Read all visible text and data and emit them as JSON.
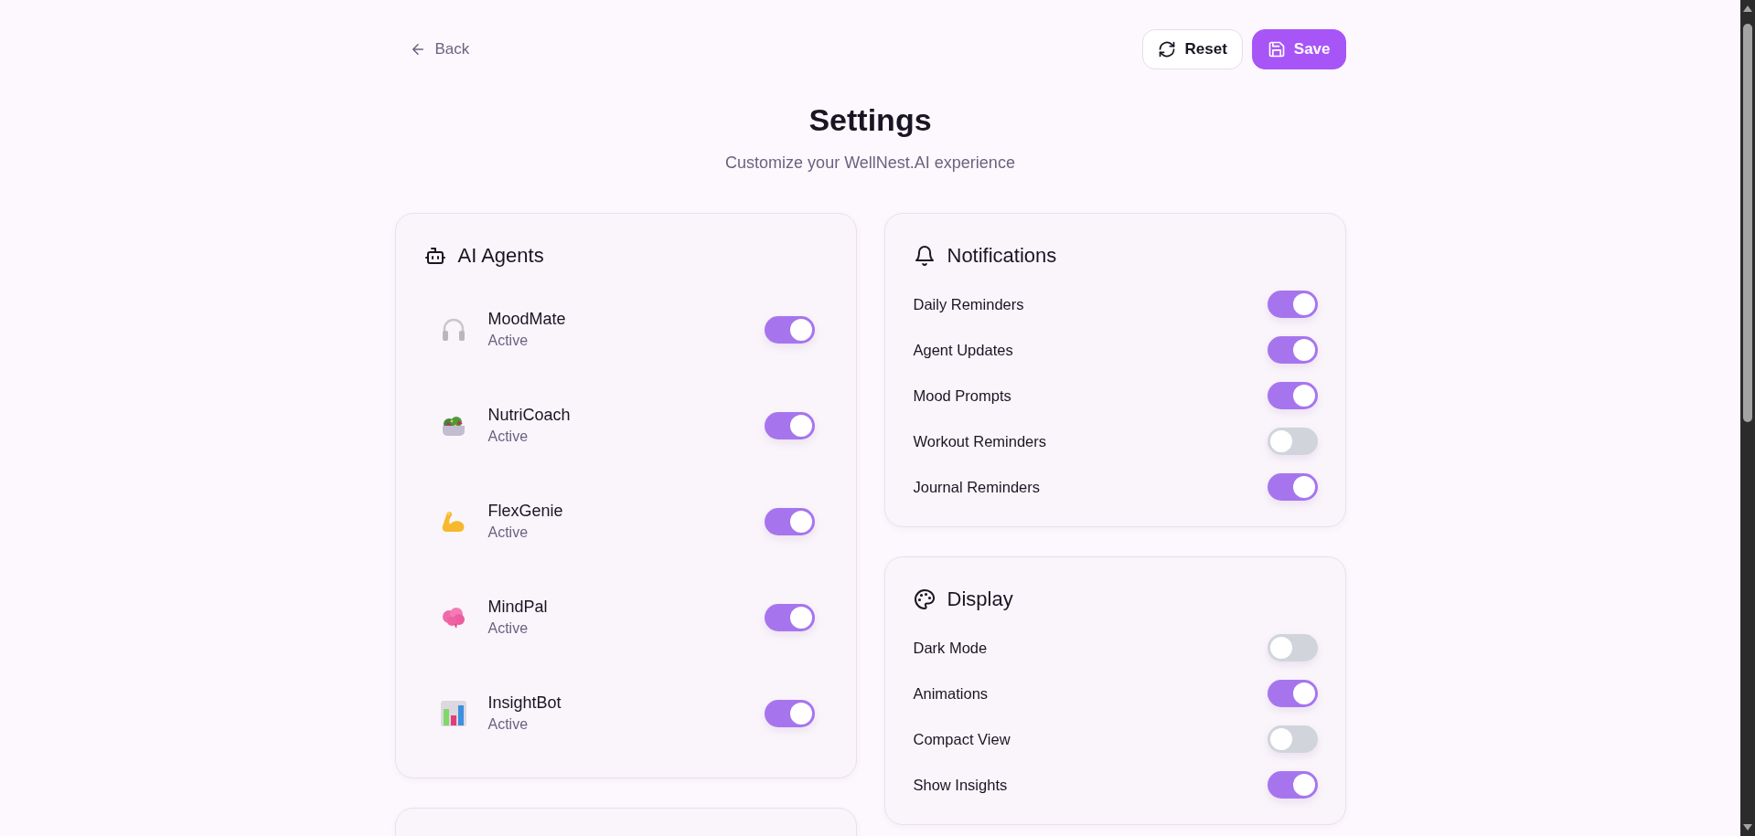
{
  "back_link": "Back",
  "buttons": [
    {
      "label": "Reset",
      "kind": "outline"
    },
    {
      "label": "Save",
      "kind": "primary"
    }
  ],
  "title": "Settings",
  "subtitle": "Customize your WellNest.AI experience",
  "columns": [
    [
      {
        "kind": "agents",
        "title": "AI Agents",
        "agents": [
          {
            "name": "MoodMate",
            "status": "Active",
            "on": true
          },
          {
            "name": "NutriCoach",
            "status": "Active",
            "on": true
          },
          {
            "name": "FlexGenie",
            "status": "Active",
            "on": true
          },
          {
            "name": "MindPal",
            "status": "Active",
            "on": true
          },
          {
            "name": "InsightBot",
            "status": "Active",
            "on": true
          }
        ]
      },
      {
        "kind": "blank"
      }
    ],
    [
      {
        "kind": "toggles",
        "title": "Notifications",
        "settings": [
          {
            "label": "Daily Reminders",
            "on": true
          },
          {
            "label": "Agent Updates",
            "on": true
          },
          {
            "label": "Mood Prompts",
            "on": true
          },
          {
            "label": "Workout Reminders",
            "on": false
          },
          {
            "label": "Journal Reminders",
            "on": true
          }
        ]
      },
      {
        "kind": "toggles",
        "title": "Display",
        "settings": [
          {
            "label": "Dark Mode",
            "on": false
          },
          {
            "label": "Animations",
            "on": true
          },
          {
            "label": "Compact View",
            "on": false
          },
          {
            "label": "Show Insights",
            "on": true
          }
        ]
      }
    ]
  ]
}
